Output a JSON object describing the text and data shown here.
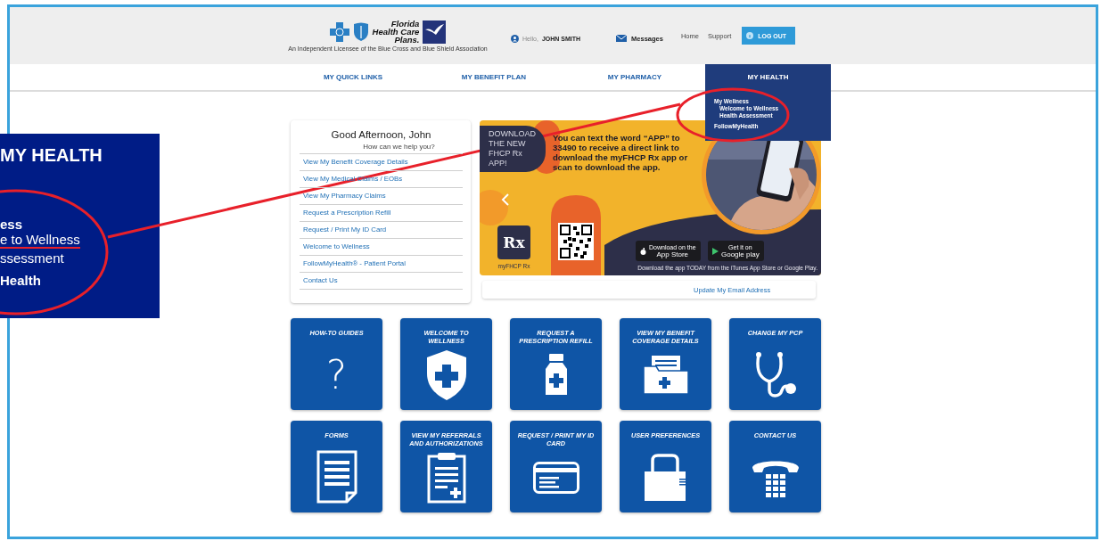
{
  "header": {
    "logo": {
      "name_lines": [
        "Florida",
        "Health Care",
        "Plans."
      ],
      "tagline": "An Independent Licensee of the Blue Cross and Blue Shield Association"
    },
    "greeting": "Hello,",
    "user_name": "JOHN SMITH",
    "messages": "Messages",
    "links": [
      "Home",
      "Support"
    ],
    "logout": "LOG OUT"
  },
  "nav": {
    "tabs": [
      {
        "label": "MY QUICK LINKS",
        "selected": false
      },
      {
        "label": "MY BENEFIT PLAN",
        "selected": false
      },
      {
        "label": "MY PHARMACY",
        "selected": false
      },
      {
        "label": "MY HEALTH",
        "selected": true
      }
    ],
    "dropdown": [
      {
        "label": "My Wellness",
        "children": [
          {
            "label": "Welcome to Wellness"
          },
          {
            "label": "Health Assessment"
          }
        ]
      },
      {
        "label": "FollowMyHealth"
      }
    ]
  },
  "quick_links": {
    "title": "Good Afternoon, John",
    "subtitle": "How can we help you?",
    "items": [
      "View My Benefit Coverage Details",
      "View My Medical Claims / EOBs",
      "View My Pharmacy Claims",
      "Request a Prescription Refill",
      "Request / Print My ID Card",
      "Welcome to Wellness",
      "FollowMyHealth® - Patient Portal",
      "Contact Us"
    ]
  },
  "banner": {
    "badge": "DOWNLOAD THE NEW FHCP Rx APP!",
    "message": "You can text the word “APP” to 33490 to receive a direct link to download the myFHCP Rx app or scan to download the app.",
    "app_icon": "Rx",
    "app_name": "myFHCP Rx",
    "app_store": {
      "small": "Download on the",
      "big": "App Store"
    },
    "google_play": {
      "small": "Get it on",
      "big": "Google play"
    },
    "footer": "Download the app TODAY from the iTunes App Store or Google Play."
  },
  "email_link": "Update My Email Address",
  "tiles": [
    {
      "label": "HOW-TO GUIDES",
      "kind": "question",
      "glyph": "?"
    },
    {
      "label": "WELCOME TO WELLNESS",
      "kind": "shield"
    },
    {
      "label": "REQUEST A PRESCRIPTION REFILL",
      "kind": "bottle"
    },
    {
      "label": "VIEW MY BENEFIT COVERAGE DETAILS",
      "kind": "folder"
    },
    {
      "label": "CHANGE MY PCP",
      "kind": "stethoscope"
    },
    {
      "label": "FORMS",
      "kind": "document"
    },
    {
      "label": "VIEW MY REFERRALS AND AUTHORIZATIONS",
      "kind": "clipboard"
    },
    {
      "label": "REQUEST / PRINT MY ID CARD",
      "kind": "card"
    },
    {
      "label": "USER PREFERENCES",
      "kind": "lock"
    },
    {
      "label": "CONTACT US",
      "kind": "phone"
    }
  ],
  "callout": {
    "title": "MY HEALTH",
    "lines": [
      {
        "text": "ess",
        "bold": true,
        "underlined": false
      },
      {
        "text": "e to Wellness",
        "bold": false,
        "underlined": true
      },
      {
        "text": "ssessment",
        "bold": false,
        "underlined": false
      },
      {
        "text": "Health",
        "bold": true,
        "underlined": false
      }
    ]
  }
}
